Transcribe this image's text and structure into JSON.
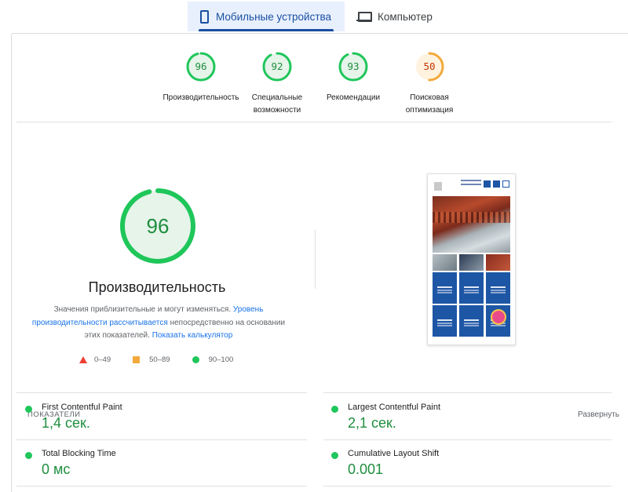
{
  "tabs": {
    "mobile_label": "Мобильные устройства",
    "desktop_label": "Компьютер"
  },
  "summary_gauges": [
    {
      "score": "96",
      "label_line1": "Производительность",
      "label_line2": "",
      "status": "good"
    },
    {
      "score": "92",
      "label_line1": "Специальные",
      "label_line2": "возможности",
      "status": "good"
    },
    {
      "score": "93",
      "label_line1": "Рекомендации",
      "label_line2": "",
      "status": "good"
    },
    {
      "score": "50",
      "label_line1": "Поисковая",
      "label_line2": "оптимизация",
      "status": "average"
    }
  ],
  "performance": {
    "score": "96",
    "title": "Производительность",
    "desc_part1": "Значения приблизительные и могут изменяться.",
    "desc_link1": "Уровень производительности рассчитывается",
    "desc_part2": "непосредственно на основании этих показателей.",
    "desc_link2": "Показать калькулятор"
  },
  "legend": {
    "fail": "0–49",
    "average": "50–89",
    "pass": "90–100"
  },
  "metrics": {
    "heading": "ПОКАЗАТЕЛИ",
    "expand_label": "Развернуть",
    "items": [
      {
        "name": "First Contentful Paint",
        "value": "1,4 сек."
      },
      {
        "name": "Largest Contentful Paint",
        "value": "2,1 сек."
      },
      {
        "name": "Total Blocking Time",
        "value": "0 мс"
      },
      {
        "name": "Cumulative Layout Shift",
        "value": "0.001"
      }
    ]
  },
  "colors": {
    "good": "#1fc65a",
    "good_text": "#1e8e3e",
    "good_fill": "#e6f4ea",
    "average": "#f2a93b",
    "average_text": "#c33300",
    "average_fill": "#fff3e0",
    "fail": "#eb4033",
    "accent": "#1a4fa0",
    "link": "#1a73e8"
  }
}
